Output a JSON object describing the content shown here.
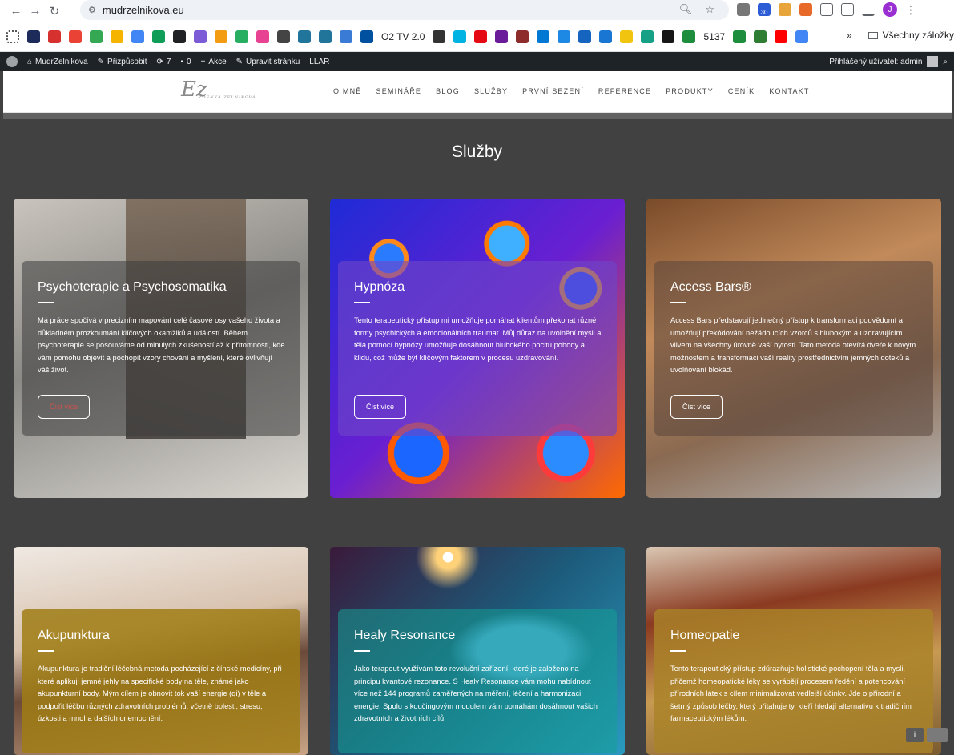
{
  "browser": {
    "url": "mudrzelnikova.eu",
    "bookmark_labels": [
      "O2 TV 2.0",
      "5137"
    ],
    "bookmarks_folder": "Všechny záložky",
    "profile_initial": "J",
    "badge_count": "30"
  },
  "wp_admin_bar": {
    "site_name": "MudrZelnikova",
    "customize": "Přizpůsobit",
    "updates": "7",
    "comments": "0",
    "new": "Akce",
    "edit": "Upravit stránku",
    "llar": "LLAR",
    "user": "Přihlášený uživatel: admin"
  },
  "site": {
    "logo_text": "Ez",
    "logo_subtitle": "ZDENKA ZELNÍKOVÁ",
    "menu": [
      "O MNĚ",
      "SEMINÁŘE",
      "BLOG",
      "SLUŽBY",
      "PRVNÍ SEZENÍ",
      "REFERENCE",
      "PRODUKTY",
      "CENÍK",
      "KONTAKT"
    ],
    "section_title": "Služby"
  },
  "cards": [
    {
      "title": "Psychoterapie a Psychosomatika",
      "text": "Má práce spočívá v precizním mapování celé časové osy vašeho života a důkladném prozkoumání klíčových okamžiků a událostí. Během psychoterapie se posouváme od minulých zkušeností až k přítomnosti, kde vám pomohu objevit a pochopit vzory chování a myšlení, které ovlivňují váš život.",
      "button": "Číst více",
      "button_color": "#c9524f"
    },
    {
      "title": "Hypnóza",
      "text": "Tento terapeutický přístup mi umožňuje pomáhat klientům překonat různé formy psychických a emocionálních traumat. Můj důraz na uvolnění mysli a těla pomocí hypnózy umožňuje dosáhnout hlubokého pocitu pohody a klidu, což může být klíčovým faktorem v procesu uzdravování.",
      "button": "Číst více",
      "button_color": "#ffffff"
    },
    {
      "title": "Access Bars®",
      "text": "Access Bars představují jedinečný přístup k transformaci podvědomí a umožňují překódování nežádoucích vzorců s hlubokým a uzdravujícím vlivem na všechny úrovně vaší bytosti. Tato metoda otevírá dveře k novým možnostem a transformaci vaší reality prostřednictvím jemných doteků a uvolňování blokád.",
      "button": "Číst více",
      "button_color": "#ffffff"
    },
    {
      "title": "Akupunktura",
      "text": "Akupunktura je tradiční léčebná metoda pocházející z čínské medicíny, při které aplikuji jemné jehly na specifické body na těle, známé jako akupunkturní body. Mým cílem je obnovit tok vaší energie (qi) v těle a podpořit léčbu různých zdravotních problémů, včetně bolesti, stresu, úzkosti a mnoha dalších onemocnění."
    },
    {
      "title": "Healy Resonance",
      "text": "Jako terapeut využívám toto revoluční zařízení, které je založeno na principu kvantové rezonance. S Healy Resonance vám mohu nabídnout více než 144 programů zaměřených na měření, léčení a harmonizaci energie. Spolu s koučingovým modulem vám pomáhám dosáhnout vašich zdravotních a životních cílů."
    },
    {
      "title": "Homeopatie",
      "text": "Tento terapeutický přístup zdůrazňuje holistické pochopení těla a mysli, přičemž homeopatické léky se vyrábějí procesem ředění a potencování přírodních látek s cílem minimalizovat vedlejší účinky. Jde o přírodní a šetrný způsob léčby, který přitahuje ty, kteří hledají alternativu k tradičním farmaceutickým lékům."
    }
  ],
  "corner_icon": "i"
}
